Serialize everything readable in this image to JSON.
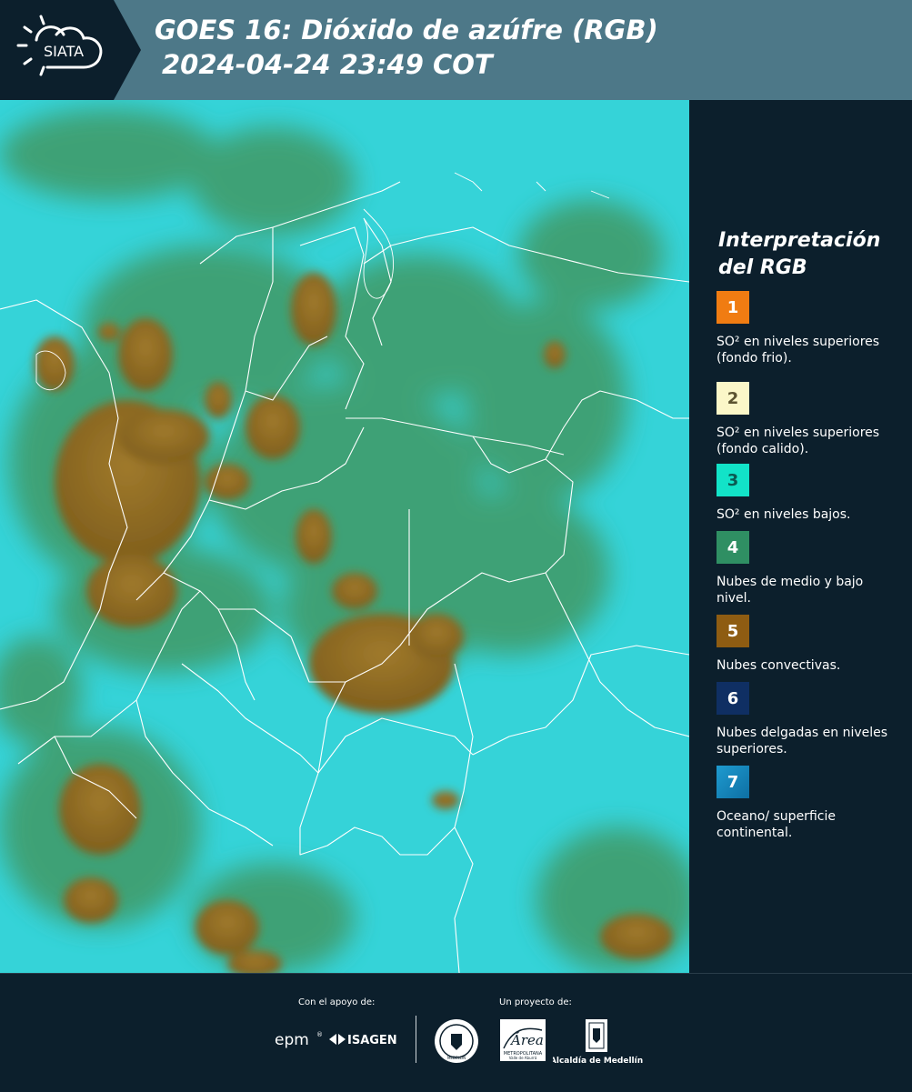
{
  "header": {
    "logo_text": "SIATA",
    "title_line1": "GOES 16: Dióxido de azúfre (RGB)",
    "title_line2": "2024-04-24 23:49 COT"
  },
  "legend": {
    "title_line1": "Interpretación",
    "title_line2": "del RGB",
    "items": [
      {
        "number": "1",
        "color": "#f07c12",
        "label": "SO² en niveles superiores (fondo frio)."
      },
      {
        "number": "2",
        "color": "#fbf7c8",
        "label": "SO² en niveles superiores (fondo calido)."
      },
      {
        "number": "3",
        "color": "#12e3c8",
        "label": "SO² en niveles bajos."
      },
      {
        "number": "4",
        "color": "#2f8f63",
        "label": "Nubes de medio y bajo nivel."
      },
      {
        "number": "5",
        "color": "#8e5c12",
        "label": "Nubes convectivas."
      },
      {
        "number": "6",
        "color": "#0f2f63",
        "label": "Nubes delgadas en niveles superiores."
      },
      {
        "number": "7",
        "color": "#1387bf",
        "label": "Oceano/ superficie continental."
      }
    ]
  },
  "footer": {
    "support_label": "Con el apoyo de:",
    "project_label": "Un proyecto de:",
    "sponsor1": "epm",
    "sponsor2": "ISAGEN",
    "partner1": "MEDELLÍN",
    "partner2_line1": "Área",
    "partner2_line2": "METROPOLITANA",
    "partner2_line3": "Valle de Aburrá",
    "partner3": "Alcaldía de Medellín"
  },
  "colors": {
    "background": "#0c1f2c",
    "header_bar": "#4d7888",
    "map_cyan": "#2fd0d6",
    "map_green": "#3d9b6a",
    "map_convective": "#8e6a22"
  }
}
